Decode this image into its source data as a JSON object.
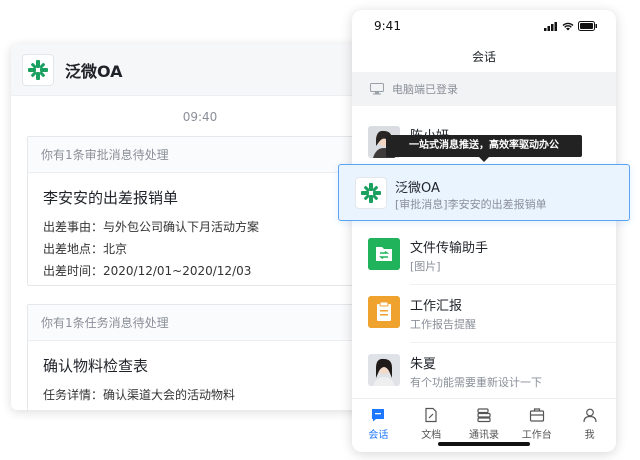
{
  "desktop": {
    "app_name": "泛微OA",
    "time": "09:40",
    "approval_card": {
      "header": "你有1条审批消息待处理",
      "title": "李安安的出差报销单",
      "lines": [
        "出差事由：与外包公司确认下月活动方案",
        "出差地点：北京",
        "出差时间：2020/12/01~2020/12/03"
      ]
    },
    "task_card": {
      "header": "你有1条任务消息待处理",
      "title": "确认物料检查表",
      "lines": [
        "任务详情：确认渠道大会的活动物料"
      ]
    }
  },
  "phone": {
    "status_time": "9:41",
    "nav_title": "会话",
    "pc_login": "电脑端已登录",
    "tooltip": "一站式消息推送，高效率驱动办公",
    "conversations": [
      {
        "name": "陈小妍",
        "message": ""
      },
      {
        "name": "泛微OA",
        "message": "[审批消息]李安安的出差报销单"
      },
      {
        "name": "文件传输助手",
        "message": "[图片]"
      },
      {
        "name": "工作汇报",
        "message": "工作报告提醒"
      },
      {
        "name": "朱夏",
        "message": "有个功能需要重新设计一下"
      }
    ],
    "tabs": [
      {
        "label": "会话",
        "icon": "chat-icon",
        "active": true
      },
      {
        "label": "文档",
        "icon": "document-icon",
        "active": false
      },
      {
        "label": "通讯录",
        "icon": "contacts-icon",
        "active": false
      },
      {
        "label": "工作台",
        "icon": "workbench-icon",
        "active": false
      },
      {
        "label": "我",
        "icon": "profile-icon",
        "active": false
      }
    ]
  },
  "colors": {
    "accent": "#1e78ff",
    "logo_green": "#1aa15f",
    "file_green": "#21b35c",
    "report_orange": "#f0a22e"
  }
}
